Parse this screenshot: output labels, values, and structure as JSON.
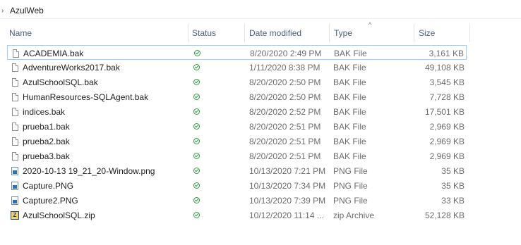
{
  "breadcrumb": {
    "chevron": "›",
    "folder": "AzulWeb"
  },
  "columns": {
    "name": "Name",
    "status": "Status",
    "date": "Date modified",
    "type": "Type",
    "size": "Size",
    "sort_indicator": "^"
  },
  "files": [
    {
      "name": "ACADEMIA.bak",
      "date": "8/20/2020 2:49 PM",
      "type": "BAK File",
      "size": "3,161 KB",
      "icon": "file-icon",
      "status": "synced-check-icon"
    },
    {
      "name": "AdventureWorks2017.bak",
      "date": "1/11/2020 8:38 PM",
      "type": "BAK File",
      "size": "49,108 KB",
      "icon": "file-icon",
      "status": "synced-check-icon"
    },
    {
      "name": "AzulSchoolSQL.bak",
      "date": "8/20/2020 2:50 PM",
      "type": "BAK File",
      "size": "3,545 KB",
      "icon": "file-icon",
      "status": "synced-check-icon"
    },
    {
      "name": "HumanResources-SQLAgent.bak",
      "date": "8/20/2020 2:50 PM",
      "type": "BAK File",
      "size": "7,728 KB",
      "icon": "file-icon",
      "status": "synced-check-icon"
    },
    {
      "name": "indices.bak",
      "date": "8/20/2020 2:52 PM",
      "type": "BAK File",
      "size": "17,501 KB",
      "icon": "file-icon",
      "status": "synced-check-icon"
    },
    {
      "name": "prueba1.bak",
      "date": "8/20/2020 2:51 PM",
      "type": "BAK File",
      "size": "2,969 KB",
      "icon": "file-icon",
      "status": "synced-check-icon"
    },
    {
      "name": "prueba2.bak",
      "date": "8/20/2020 2:51 PM",
      "type": "BAK File",
      "size": "2,969 KB",
      "icon": "file-icon",
      "status": "synced-check-icon"
    },
    {
      "name": "prueba3.bak",
      "date": "8/20/2020 2:51 PM",
      "type": "BAK File",
      "size": "2,969 KB",
      "icon": "file-icon",
      "status": "synced-check-icon"
    },
    {
      "name": "2020-10-13 19_21_20-Window.png",
      "date": "10/13/2020 7:21 PM",
      "type": "PNG File",
      "size": "35 KB",
      "icon": "image-file-icon",
      "status": "synced-check-icon"
    },
    {
      "name": "Capture.PNG",
      "date": "10/13/2020 7:34 PM",
      "type": "PNG File",
      "size": "35 KB",
      "icon": "image-file-icon",
      "status": "synced-check-icon"
    },
    {
      "name": "Capture2.PNG",
      "date": "10/13/2020 7:39 PM",
      "type": "PNG File",
      "size": "33 KB",
      "icon": "image-file-icon",
      "status": "synced-check-icon"
    },
    {
      "name": "AzulSchoolSQL.zip",
      "date": "10/12/2020 11:14 ...",
      "type": "zip Archive",
      "size": "52,128 KB",
      "icon": "zip-archive-icon",
      "status": "synced-check-icon"
    }
  ],
  "colors": {
    "status_green": "#2e9e3e",
    "header_text": "#4c607a",
    "focus_border": "#99d1ff"
  }
}
